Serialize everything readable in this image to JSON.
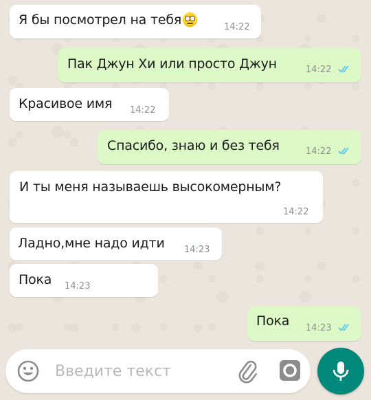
{
  "messages": [
    {
      "text": "Я бы посмотрел на тебя",
      "emoji": "face-with-rolling-eyes",
      "time": "14:22",
      "direction": "incoming"
    },
    {
      "text": "Пак Джун Хи или просто Джун",
      "time": "14:22",
      "direction": "outgoing",
      "status": "read"
    },
    {
      "text": "Красивое имя",
      "time": "14:22",
      "direction": "incoming"
    },
    {
      "text": "Спасибо, знаю и без тебя",
      "time": "14:22",
      "direction": "outgoing",
      "status": "read"
    },
    {
      "text": "И ты меня называешь высокомерным?",
      "time": "14:22",
      "direction": "incoming"
    },
    {
      "text": "Ладно,мне надо идти",
      "time": "14:23",
      "direction": "incoming"
    },
    {
      "text": "Пока",
      "time": "14:23",
      "direction": "incoming"
    },
    {
      "text": "Пока",
      "time": "14:23",
      "direction": "outgoing",
      "status": "read"
    }
  ],
  "composer": {
    "placeholder": "Введите текст",
    "icons": [
      "emoji-icon",
      "attach-icon",
      "camera-icon",
      "mic-icon"
    ]
  },
  "colors": {
    "background": "#ece5dd",
    "incoming_bubble": "#ffffff",
    "outgoing_bubble": "#dcf8c6",
    "read_ticks": "#4fc3f7",
    "mic_button": "#00897b"
  }
}
